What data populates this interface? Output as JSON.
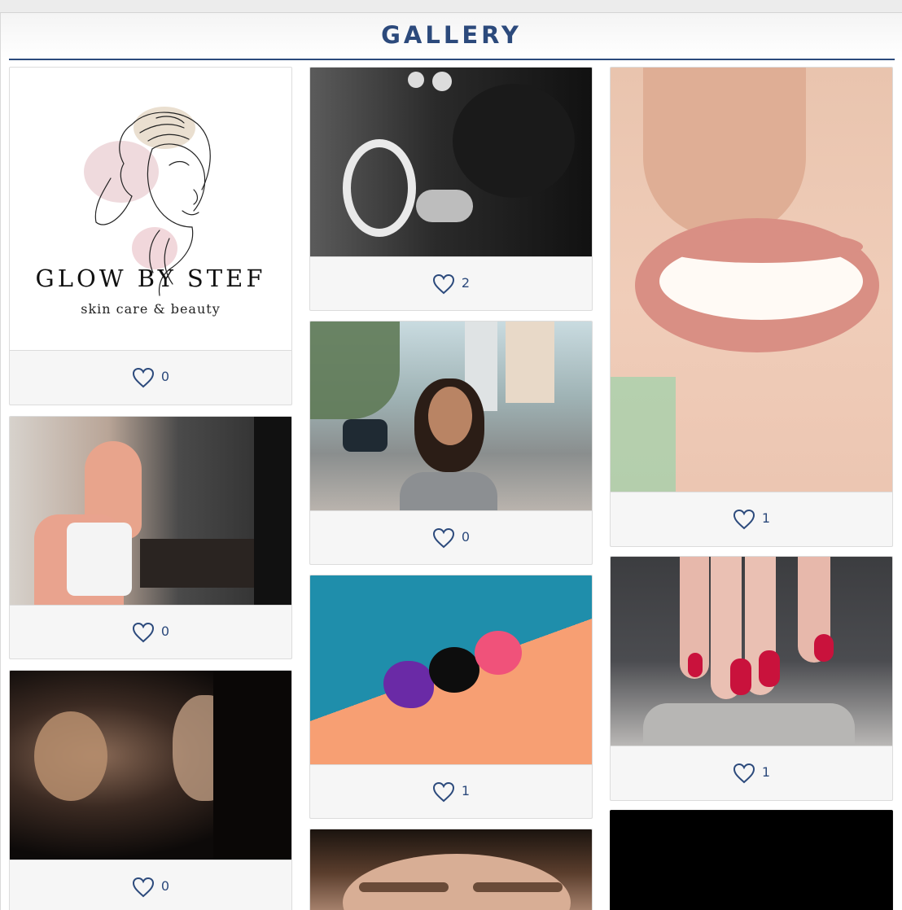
{
  "page": {
    "title": "GALLERY"
  },
  "logo": {
    "brand": "GLOW BY STEF",
    "tagline": "skin care & beauty"
  },
  "gallery": {
    "items": [
      {
        "alt": "Glow by Stef logo",
        "likes": "0"
      },
      {
        "alt": "makeup artist at ring light mirror",
        "likes": "2"
      },
      {
        "alt": "smiling lips close-up",
        "likes": "1"
      },
      {
        "alt": "woman in hijab applying makeup",
        "likes": "0"
      },
      {
        "alt": "smiling woman with glasses on city street",
        "likes": "0"
      },
      {
        "alt": "red nails with love lettering",
        "likes": "1"
      },
      {
        "alt": "makeup artist working on client",
        "likes": "0"
      },
      {
        "alt": "makeup sponges on teal and orange",
        "likes": "1"
      },
      {
        "alt": "eyebrow close-up",
        "likes": ""
      },
      {
        "alt": "dark photo",
        "likes": ""
      }
    ]
  },
  "colors": {
    "accent": "#2c4a7c",
    "card_bg": "#f6f6f6"
  },
  "icons": {
    "like": "heart-outline-icon"
  }
}
